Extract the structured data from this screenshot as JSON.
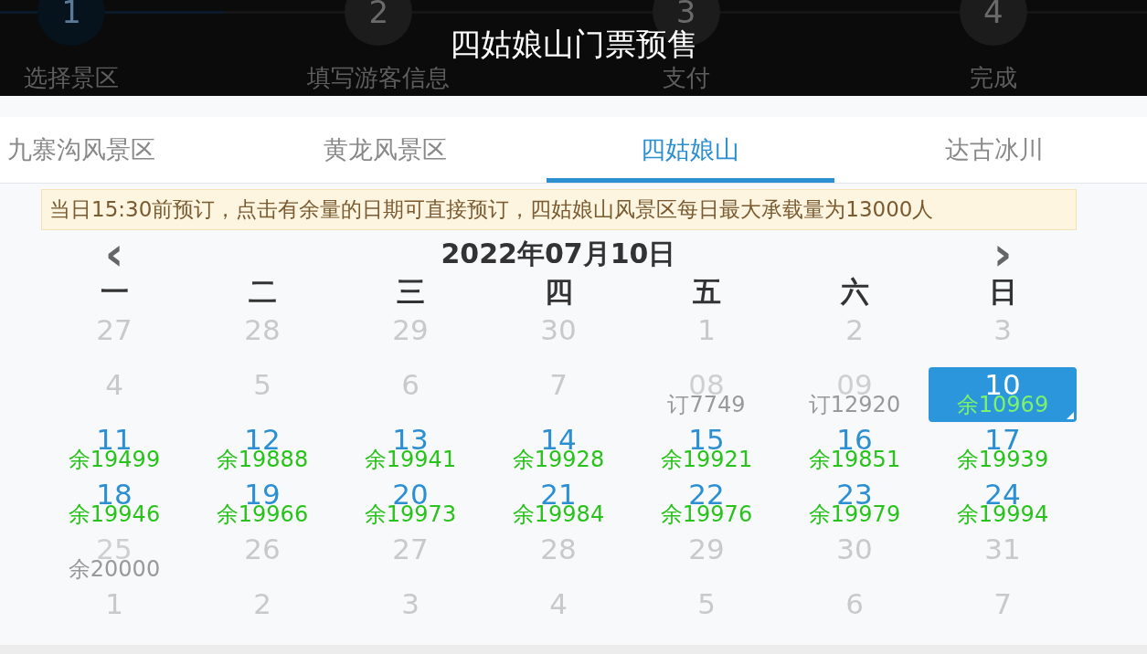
{
  "header": {
    "title": "四姑娘山门票预售",
    "steps": [
      {
        "number": "1",
        "label": "选择景区",
        "selected": true
      },
      {
        "number": "2",
        "label": "填写游客信息",
        "selected": false
      },
      {
        "number": "3",
        "label": "支付",
        "selected": false
      },
      {
        "number": "4",
        "label": "完成",
        "selected": false
      }
    ]
  },
  "tabs": [
    {
      "label": "九寨沟风景区",
      "selected": false
    },
    {
      "label": "黄龙风景区",
      "selected": false
    },
    {
      "label": "四姑娘山",
      "selected": true
    },
    {
      "label": "达古冰川",
      "selected": false
    }
  ],
  "notice": "当日15:30前预订，点击有余量的日期可直接预订，四姑娘山风景区每日最大承载量为13000人",
  "calendar": {
    "prev": "‹",
    "next": "›",
    "title": "2022年07月10日",
    "weekdays": [
      "一",
      "二",
      "三",
      "四",
      "五",
      "六",
      "日"
    ],
    "days": [
      {
        "day": "27",
        "kind": "muted",
        "selected": false
      },
      {
        "day": "28",
        "kind": "muted",
        "selected": false
      },
      {
        "day": "29",
        "kind": "muted",
        "selected": false
      },
      {
        "day": "30",
        "kind": "muted",
        "selected": false
      },
      {
        "day": "1",
        "kind": "muted",
        "selected": false
      },
      {
        "day": "2",
        "kind": "muted",
        "selected": false
      },
      {
        "day": "3",
        "kind": "muted",
        "selected": false
      },
      {
        "day": "4",
        "kind": "muted",
        "selected": false
      },
      {
        "day": "5",
        "kind": "muted",
        "selected": false
      },
      {
        "day": "6",
        "kind": "muted",
        "selected": false
      },
      {
        "day": "7",
        "kind": "muted",
        "selected": false
      },
      {
        "day": "08",
        "kind": "closed",
        "label": "订7749",
        "selected": false
      },
      {
        "day": "09",
        "kind": "closed",
        "label": "订12920",
        "selected": false
      },
      {
        "day": "10",
        "kind": "available",
        "label": "余10969",
        "selected": true
      },
      {
        "day": "11",
        "kind": "available",
        "label": "余19499",
        "selected": false
      },
      {
        "day": "12",
        "kind": "available",
        "label": "余19888",
        "selected": false
      },
      {
        "day": "13",
        "kind": "available",
        "label": "余19941",
        "selected": false
      },
      {
        "day": "14",
        "kind": "available",
        "label": "余19928",
        "selected": false
      },
      {
        "day": "15",
        "kind": "available",
        "label": "余19921",
        "selected": false
      },
      {
        "day": "16",
        "kind": "available",
        "label": "余19851",
        "selected": false
      },
      {
        "day": "17",
        "kind": "available",
        "label": "余19939",
        "selected": false
      },
      {
        "day": "18",
        "kind": "available",
        "label": "余19946",
        "selected": false
      },
      {
        "day": "19",
        "kind": "available",
        "label": "余19966",
        "selected": false
      },
      {
        "day": "20",
        "kind": "available",
        "label": "余19973",
        "selected": false
      },
      {
        "day": "21",
        "kind": "available",
        "label": "余19984",
        "selected": false
      },
      {
        "day": "22",
        "kind": "available",
        "label": "余19976",
        "selected": false
      },
      {
        "day": "23",
        "kind": "available",
        "label": "余19979",
        "selected": false
      },
      {
        "day": "24",
        "kind": "available",
        "label": "余19994",
        "selected": false
      },
      {
        "day": "25",
        "kind": "closed",
        "label": "余20000",
        "selected": false
      },
      {
        "day": "26",
        "kind": "muted",
        "selected": false
      },
      {
        "day": "27",
        "kind": "muted",
        "selected": false
      },
      {
        "day": "28",
        "kind": "muted",
        "selected": false
      },
      {
        "day": "29",
        "kind": "muted",
        "selected": false
      },
      {
        "day": "30",
        "kind": "muted",
        "selected": false
      },
      {
        "day": "31",
        "kind": "muted",
        "selected": false
      },
      {
        "day": "1",
        "kind": "muted",
        "selected": false
      },
      {
        "day": "2",
        "kind": "muted",
        "selected": false
      },
      {
        "day": "3",
        "kind": "muted",
        "selected": false
      },
      {
        "day": "4",
        "kind": "muted",
        "selected": false
      },
      {
        "day": "5",
        "kind": "muted",
        "selected": false
      },
      {
        "day": "6",
        "kind": "muted",
        "selected": false
      },
      {
        "day": "7",
        "kind": "muted",
        "selected": false
      }
    ]
  }
}
